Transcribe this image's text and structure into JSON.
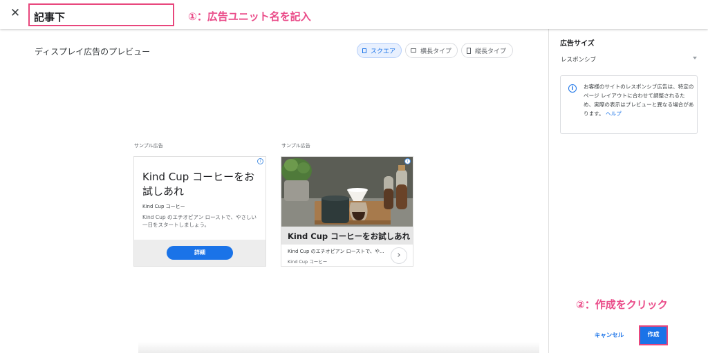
{
  "header": {
    "close_icon": "close-icon",
    "ad_unit_name": "記事下",
    "annotation_1": "①：広告ユニット名を記入"
  },
  "preview": {
    "title": "ディスプレイ広告のプレビュー",
    "shape_options": [
      {
        "label": "スクエア",
        "icon": "square-icon",
        "selected": true
      },
      {
        "label": "横長タイプ",
        "icon": "landscape-icon",
        "selected": false
      },
      {
        "label": "縦長タイプ",
        "icon": "portrait-icon",
        "selected": false
      }
    ],
    "ad_text": {
      "sample_label": "サンプル広告",
      "headline": "Kind Cup コーヒーをお試しあれ",
      "brand": "Kind Cup コーヒー",
      "description": "Kind Cup のエチオピアン ローストで、やさしい一日をスタートしましょう。",
      "cta": "詳細",
      "ad_choices_icon": "info-icon"
    },
    "ad_image": {
      "headline": "Kind Cup コーヒーをお試しあれ",
      "description": "Kind Cup のエチオピアン ローストで、や...",
      "brand": "Kind Cup コーヒー",
      "next_icon": "chevron-right-icon"
    }
  },
  "sidebar": {
    "title": "広告サイズ",
    "size_value": "レスポンシブ",
    "info": {
      "text": "お客様のサイトのレスポンシブ広告は、特定のページ レイアウトに合わせて調整されるため、実際の表示はプレビューと異なる場合があります。",
      "link": "ヘルプ"
    }
  },
  "footer": {
    "annotation_2": "②：作成をクリック",
    "cancel": "キャンセル",
    "create": "作成"
  },
  "colors": {
    "accent": "#1a73e8",
    "annotation": "#ea4c89",
    "highlight_border": "#e8467c"
  }
}
